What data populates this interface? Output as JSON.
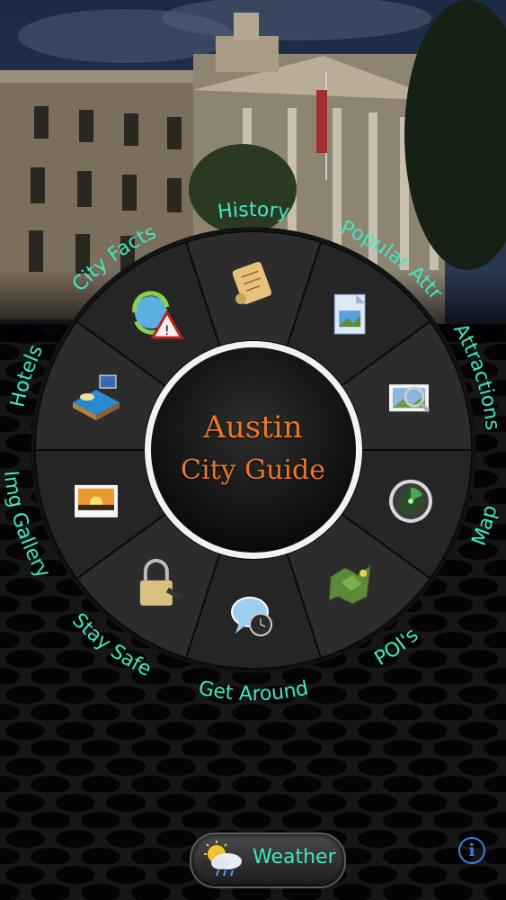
{
  "app": {
    "title_line1": "Austin",
    "title_line2": "City Guide"
  },
  "menu": {
    "items": [
      {
        "label": "History",
        "icon": "scroll-icon"
      },
      {
        "label": "Popular Attr",
        "icon": "document-image-icon"
      },
      {
        "label": "Attractions",
        "icon": "magnifier-photo-icon"
      },
      {
        "label": "Map",
        "icon": "radar-map-icon"
      },
      {
        "label": "POI's",
        "icon": "terrain-map-icon"
      },
      {
        "label": "Get Around",
        "icon": "speech-clock-icon"
      },
      {
        "label": "Stay Safe",
        "icon": "padlock-icon"
      },
      {
        "label": "Img Gallery",
        "icon": "sunset-photo-icon"
      },
      {
        "label": "Hotels",
        "icon": "bed-icon"
      },
      {
        "label": "City Facts",
        "icon": "globe-warning-icon"
      }
    ]
  },
  "weather": {
    "label": "Weather",
    "icon": "sun-cloud-rain-icon"
  },
  "info": {
    "label": "i"
  },
  "colors": {
    "accent": "#40e8c0",
    "title": "#e8772a",
    "info": "#3f7fe0"
  }
}
